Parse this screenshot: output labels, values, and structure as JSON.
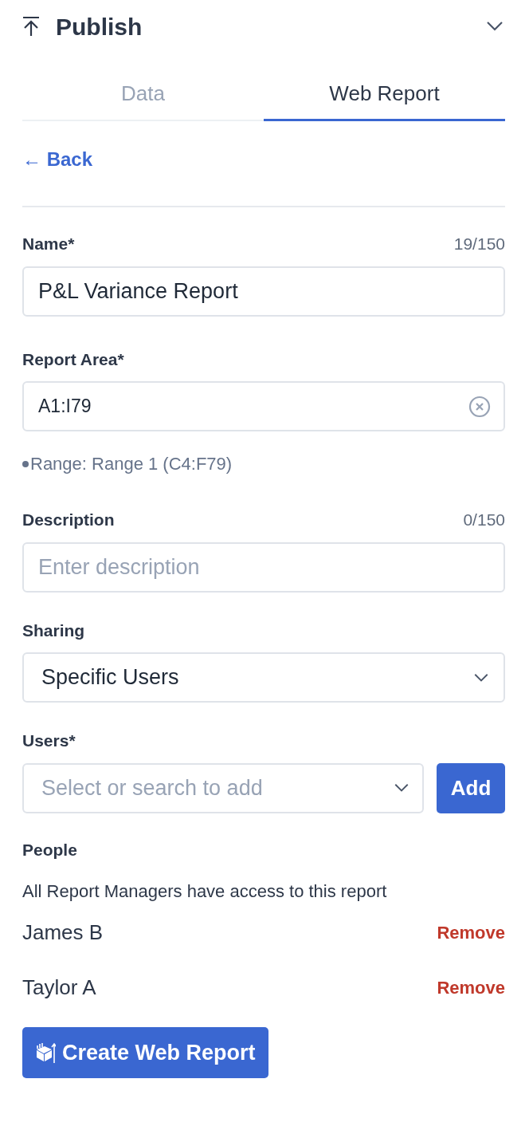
{
  "panel": {
    "title": "Publish",
    "expanded": true
  },
  "tabs": [
    {
      "label": "Data",
      "selected": false
    },
    {
      "label": "Web Report",
      "selected": true
    }
  ],
  "back_link": "← Back",
  "name_field": {
    "label": "Name*",
    "counter": "19/150",
    "value": "P&L Variance Report"
  },
  "report_area": {
    "label": "Report Area*",
    "value": "A1:I79",
    "hint": "Range: Range 1 (C4:F79)"
  },
  "description": {
    "label": "Description",
    "counter": "0/150",
    "placeholder": "Enter description"
  },
  "sharing": {
    "label": "Sharing",
    "value": "Specific Users"
  },
  "users": {
    "label": "Users*",
    "placeholder": "Select or search to add",
    "add_button": "Add"
  },
  "people": {
    "title": "People",
    "note": "All Report Managers have access to this report",
    "items": [
      {
        "name": "James B",
        "action": "Remove"
      },
      {
        "name": "Taylor A",
        "action": "Remove"
      }
    ]
  },
  "submit_button": "Create Web Report"
}
